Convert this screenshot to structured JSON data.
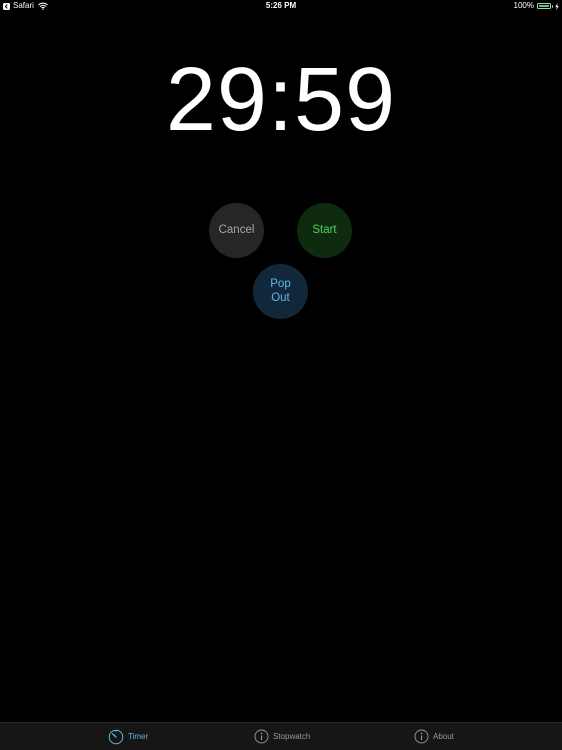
{
  "status_bar": {
    "back_app": "Safari",
    "time": "5:26 PM",
    "battery_percent": "100%",
    "battery_level": 1.0,
    "battery_color": "#4cd964"
  },
  "timer": {
    "display": "29:59"
  },
  "buttons": {
    "cancel": "Cancel",
    "start": "Start",
    "popout_line1": "Pop",
    "popout_line2": "Out"
  },
  "tabs": [
    {
      "label": "Timer",
      "icon": "timer-icon",
      "active": true
    },
    {
      "label": "Stopwatch",
      "icon": "info-icon",
      "active": false
    },
    {
      "label": "About",
      "icon": "info-icon",
      "active": false
    }
  ],
  "colors": {
    "background": "#000000",
    "accent_blue": "#5fb5e6",
    "start_green": "#4fd05b",
    "cancel_gray": "#a6a6a6",
    "tab_inactive": "#9a9a9a"
  }
}
